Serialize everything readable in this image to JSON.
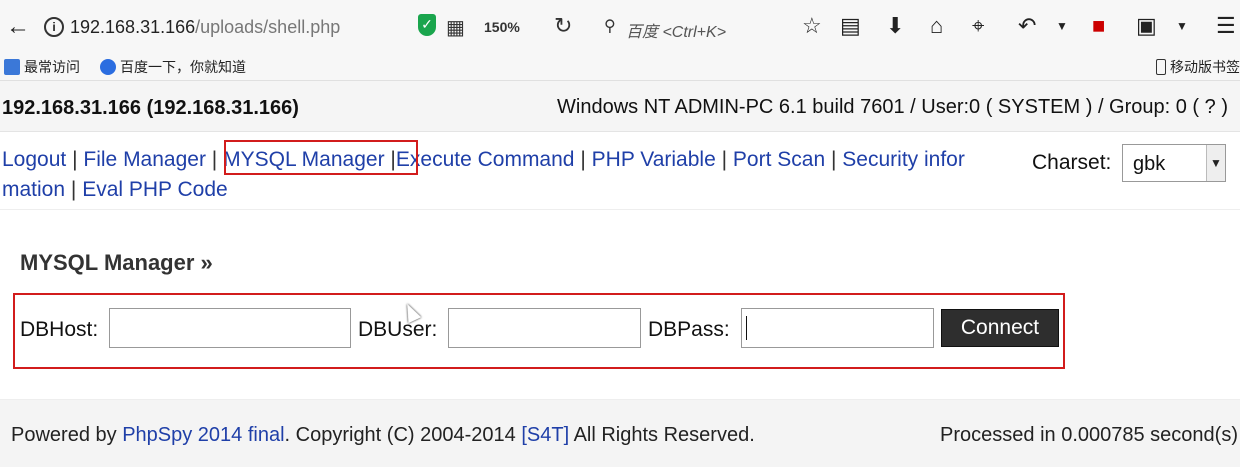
{
  "browser": {
    "url_host": "192.168.31.166",
    "url_path": "/uploads/shell.php",
    "zoom": "150%",
    "search_placeholder": "百度 <Ctrl+K>",
    "bookmarks": [
      "最常访问",
      "百度一下，你就知道"
    ],
    "mobile_bookmarks": "移动版书签"
  },
  "info": {
    "host": "192.168.31.166 (192.168.31.166)",
    "system": "Windows NT ADMIN-PC 6.1 build 7601 / User:0 ( SYSTEM ) / Group: 0 ( ? )"
  },
  "nav": {
    "items": [
      "Logout",
      "File Manager",
      "MYSQL Manager",
      "Execute Command",
      "PHP Variable",
      "Port Scan",
      "Security infor",
      "mation",
      "Eval PHP Code"
    ],
    "separator": "|"
  },
  "charset": {
    "label": "Charset:",
    "value": "gbk"
  },
  "main": {
    "title": "MYSQL Manager »",
    "dbhost_label": "DBHost:",
    "dbuser_label": "DBUser:",
    "dbpass_label": "DBPass:",
    "dbhost_value": "",
    "dbuser_value": "",
    "dbpass_value": "",
    "connect_label": "Connect"
  },
  "footer": {
    "powered_by": "Powered by",
    "product": "PhpSpy 2014 final",
    "copyright": ". Copyright (C) 2004-2014",
    "team": "[S4T]",
    "rights": "All Rights Reserved.",
    "processed": "Processed in 0.000785 second(s)"
  },
  "colors": {
    "link": "#1f3fa8",
    "highlight": "#d21c1c",
    "button": "#2e2e2e"
  }
}
